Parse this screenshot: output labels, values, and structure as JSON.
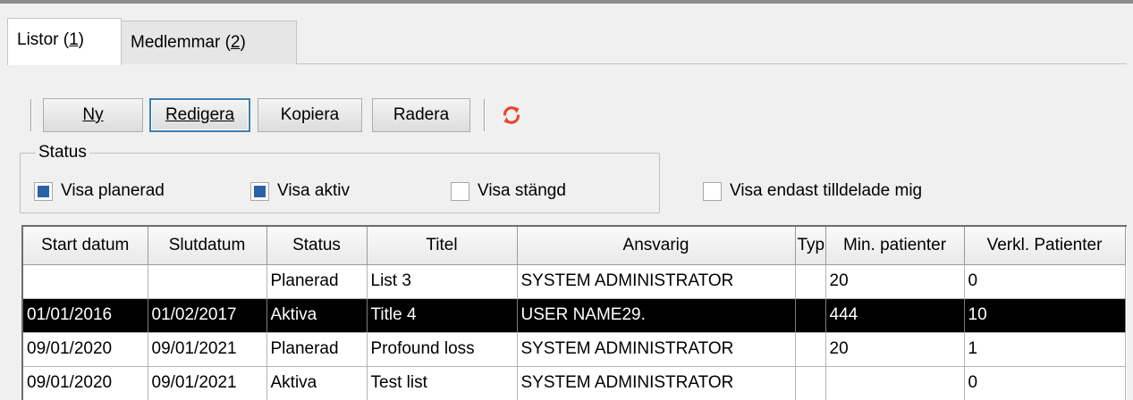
{
  "tabs": [
    {
      "label": "Listor",
      "mnemonic": "1"
    },
    {
      "label": "Medlemmar",
      "mnemonic": "2"
    }
  ],
  "toolbar": {
    "new_label": "Ny",
    "edit_label": "Redigera",
    "copy_label": "Kopiera",
    "delete_label": "Radera",
    "refresh_icon": "refresh-icon"
  },
  "status_filter": {
    "title": "Status",
    "options": [
      {
        "label": "Visa planerad",
        "checked": true
      },
      {
        "label": "Visa aktiv",
        "checked": true
      },
      {
        "label": "Visa stängd",
        "checked": false
      },
      {
        "label": "Visa endast tilldelade mig",
        "checked": false
      }
    ]
  },
  "table": {
    "columns": [
      "Start datum",
      "Slutdatum",
      "Status",
      "Titel",
      "Ansvarig",
      "Typ",
      "Min. patienter",
      "Verkl. Patienter"
    ],
    "rows": [
      {
        "start": "",
        "end": "",
        "status": "Planerad",
        "title": "List 3",
        "owner": "SYSTEM ADMINISTRATOR",
        "type": "",
        "min": "20",
        "actual": "0",
        "selected": false
      },
      {
        "start": "01/01/2016",
        "end": "01/02/2017",
        "status": "Aktiva",
        "title": "Title 4",
        "owner": "USER NAME29.",
        "type": "",
        "min": "444",
        "actual": "10",
        "selected": true
      },
      {
        "start": "09/01/2020",
        "end": "09/01/2021",
        "status": "Planerad",
        "title": "Profound loss",
        "owner": "SYSTEM ADMINISTRATOR",
        "type": "",
        "min": "20",
        "actual": "1",
        "selected": false
      },
      {
        "start": "09/01/2020",
        "end": "09/01/2021",
        "status": "Aktiva",
        "title": "Test list",
        "owner": "SYSTEM ADMINISTRATOR",
        "type": "",
        "min": "",
        "actual": "0",
        "selected": false
      }
    ]
  },
  "colors": {
    "selection": "#000000",
    "checkbox_fill": "#2a62a8",
    "default_button_border": "#3c7fb1",
    "refresh_icon": "#e8442a"
  }
}
